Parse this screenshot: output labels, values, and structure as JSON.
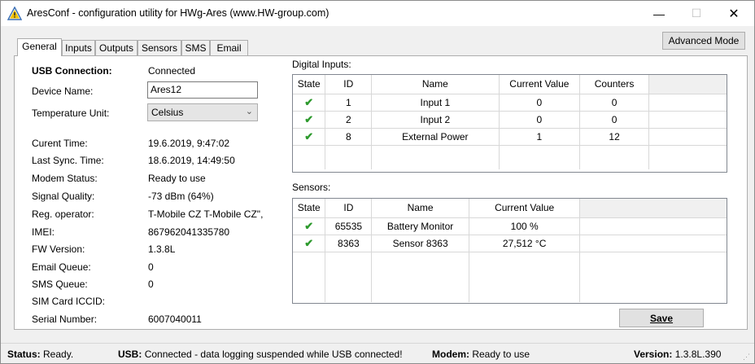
{
  "window": {
    "title": "AresConf - configuration utility for HWg-Ares (www.HW-group.com)",
    "minimize": "—",
    "maximize": "☐",
    "close": "✕"
  },
  "tabs": [
    "General",
    "Inputs",
    "Outputs",
    "Sensors",
    "SMS",
    "Email"
  ],
  "advanced_mode_label": "Advanced Mode",
  "general": {
    "usb_connection_label": "USB Connection:",
    "usb_connection_value": "Connected",
    "device_name_label": "Device Name:",
    "device_name_value": "Ares12",
    "temperature_unit_label": "Temperature Unit:",
    "temperature_unit_value": "Celsius",
    "info": [
      {
        "label": "Curent Time:",
        "value": "19.6.2019, 9:47:02"
      },
      {
        "label": "Last Sync. Time:",
        "value": "18.6.2019, 14:49:50"
      },
      {
        "label": "Modem Status:",
        "value": "Ready to use"
      },
      {
        "label": "Signal Quality:",
        "value": "-73 dBm (64%)"
      },
      {
        "label": "Reg. operator:",
        "value": "T-Mobile CZ T-Mobile CZ\","
      },
      {
        "label": "IMEI:",
        "value": "867962041335780"
      },
      {
        "label": "FW Version:",
        "value": "1.3.8L"
      },
      {
        "label": "Email Queue:",
        "value": "0"
      },
      {
        "label": "SMS Queue:",
        "value": "0"
      },
      {
        "label": "SIM Card ICCID:",
        "value": ""
      },
      {
        "label": "Serial Number:",
        "value": "6007040011"
      }
    ]
  },
  "digital_inputs": {
    "title": "Digital Inputs:",
    "columns": [
      "State",
      "ID",
      "Name",
      "Current Value",
      "Counters"
    ],
    "rows": [
      {
        "id": "1",
        "name": "Input 1",
        "value": "0",
        "counters": "0"
      },
      {
        "id": "2",
        "name": "Input 2",
        "value": "0",
        "counters": "0"
      },
      {
        "id": "8",
        "name": "External Power",
        "value": "1",
        "counters": "12"
      }
    ]
  },
  "sensors": {
    "title": "Sensors:",
    "columns": [
      "State",
      "ID",
      "Name",
      "Current Value"
    ],
    "rows": [
      {
        "id": "65535",
        "name": "Battery Monitor",
        "value": "100 %"
      },
      {
        "id": "8363",
        "name": "Sensor 8363",
        "value": "27,512 °C"
      }
    ]
  },
  "save_label": "Save",
  "status": {
    "status_label": "Status:",
    "status_value": "Ready.",
    "usb_label": "USB:",
    "usb_value": "Connected - data logging suspended while USB connected!",
    "modem_label": "Modem:",
    "modem_value": "Ready to use",
    "version_label": "Version:",
    "version_value": "1.3.8L.390"
  },
  "colors": {
    "ok_state": "#2e9a2e",
    "warning_icon": "#f2c200"
  },
  "icons": {
    "app": "warning-triangle-icon",
    "state_ok": "check-icon"
  }
}
